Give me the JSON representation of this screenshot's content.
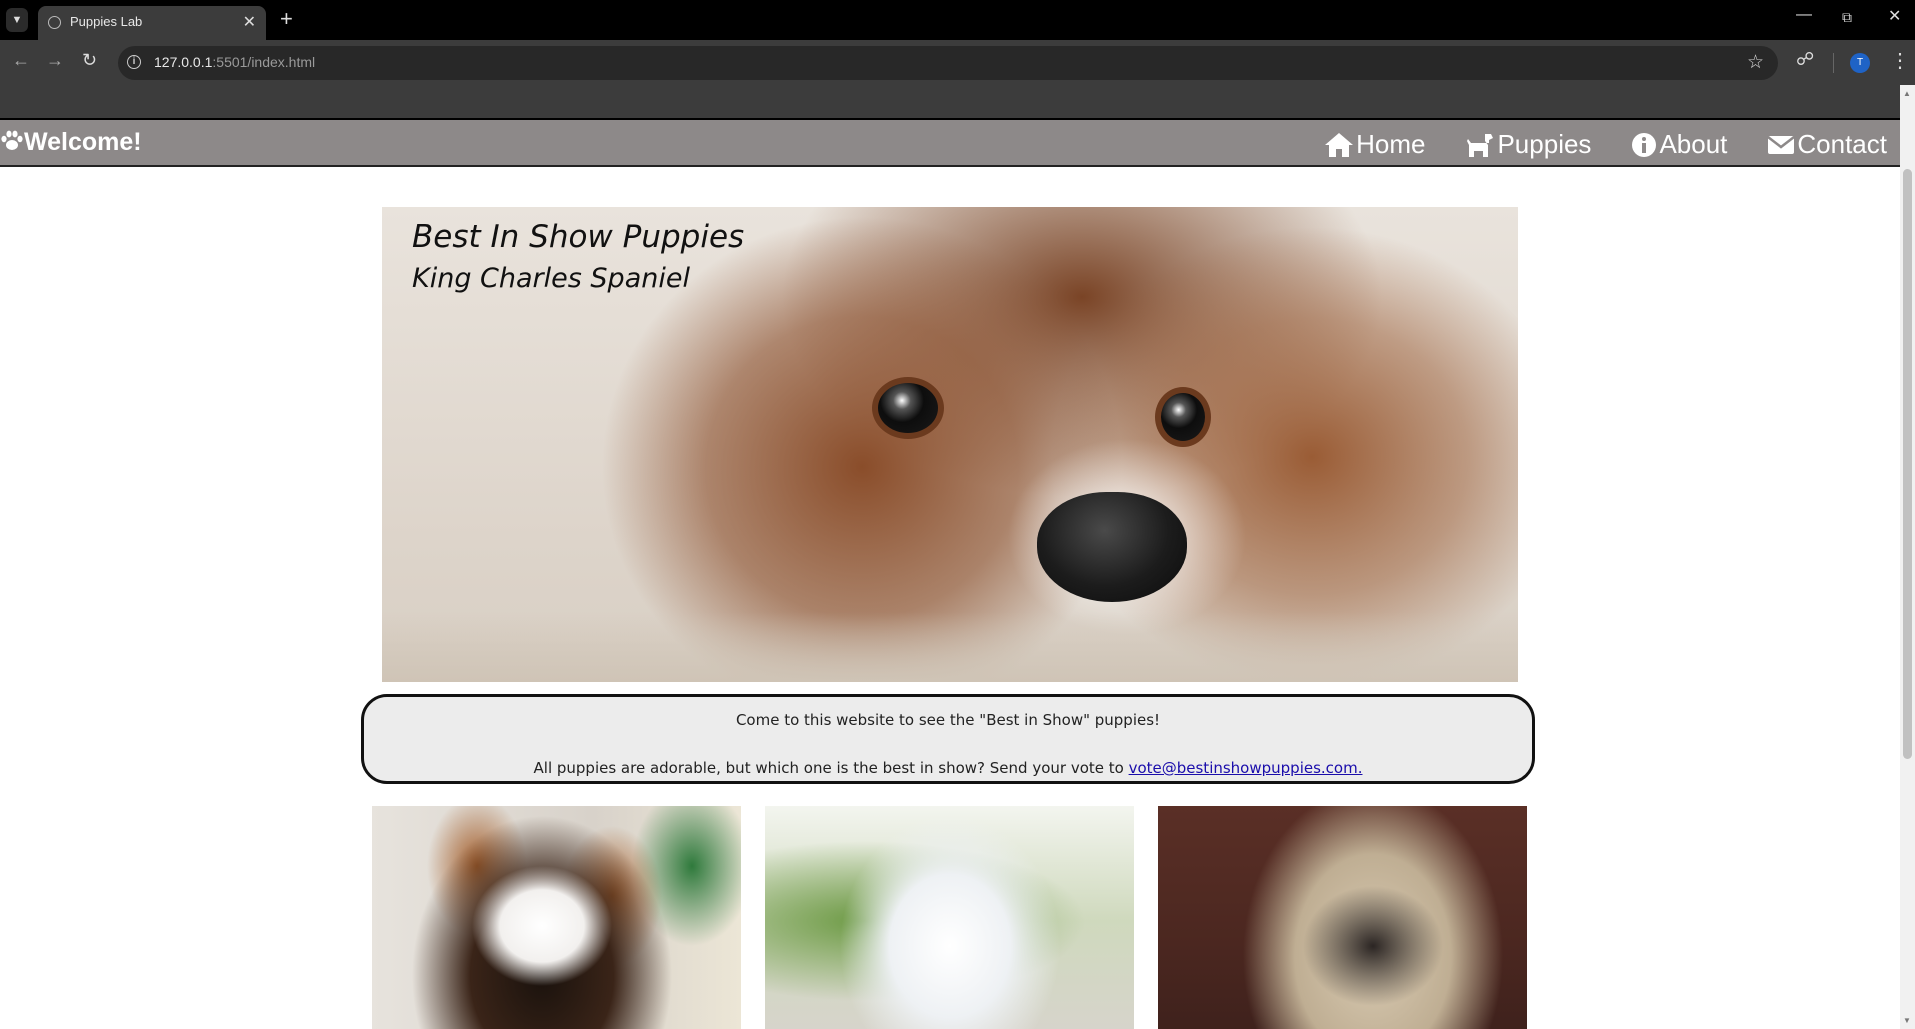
{
  "browser": {
    "tab_title": "Puppies Lab",
    "url_host": "127.0.0.1",
    "url_path": ":5501/index.html",
    "profile_initial": "T"
  },
  "site": {
    "brand": "Welcome!",
    "nav": [
      {
        "label": "Home",
        "icon": "home-icon"
      },
      {
        "label": "Puppies",
        "icon": "dog-icon"
      },
      {
        "label": "About",
        "icon": "info-circle-icon"
      },
      {
        "label": "Contact",
        "icon": "envelope-icon"
      }
    ]
  },
  "hero": {
    "title": "Best In Show Puppies",
    "subtitle": "King Charles Spaniel"
  },
  "intro": {
    "line1": "Come to this website to see the \"Best in Show\" puppies!",
    "line2_prefix": "All puppies are adorable, but which one is the best in show? Send your vote to ",
    "email": "vote@bestinshowpuppies.com."
  },
  "colors": {
    "nav_background": "#8d8989",
    "intro_background": "#ececec",
    "link": "#1a0dab"
  }
}
